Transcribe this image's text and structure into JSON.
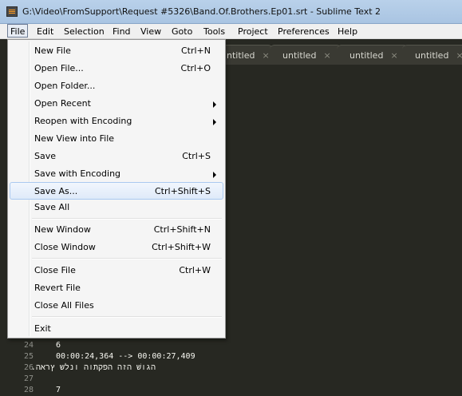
{
  "window": {
    "title": "G:\\Video\\FromSupport\\Request #5326\\Band.Of.Brothers.Ep01.srt - Sublime Text 2"
  },
  "menubar": [
    "File",
    "Edit",
    "Selection",
    "Find",
    "View",
    "Goto",
    "Tools",
    "Project",
    "Preferences",
    "Help"
  ],
  "tabs": [
    {
      "label": "ntitled",
      "close": "×"
    },
    {
      "label": "untitled",
      "close": "×"
    },
    {
      "label": "untitled",
      "close": "×"
    },
    {
      "label": "untitled",
      "close": "×"
    }
  ],
  "file_menu": {
    "items": [
      {
        "label": "New File",
        "shortcut": "Ctrl+N"
      },
      {
        "label": "Open File...",
        "shortcut": "Ctrl+O"
      },
      {
        "label": "Open Folder...",
        "shortcut": ""
      },
      {
        "label": "Open Recent",
        "shortcut": ""
      },
      {
        "label": "Reopen with Encoding",
        "shortcut": ""
      },
      {
        "label": "New View into File",
        "shortcut": ""
      },
      {
        "label": "Save",
        "shortcut": "Ctrl+S"
      },
      {
        "label": "Save with Encoding",
        "shortcut": ""
      },
      {
        "label": "Save As...",
        "shortcut": "Ctrl+Shift+S"
      },
      {
        "label": "Save All",
        "shortcut": ""
      },
      {
        "label": "New Window",
        "shortcut": "Ctrl+Shift+N"
      },
      {
        "label": "Close Window",
        "shortcut": "Ctrl+Shift+W"
      },
      {
        "label": "Close File",
        "shortcut": "Ctrl+W"
      },
      {
        "label": "Revert File",
        "shortcut": ""
      },
      {
        "label": "Close All Files",
        "shortcut": ""
      },
      {
        "label": "Exit",
        "shortcut": ""
      }
    ]
  },
  "editor": {
    "lines": [
      {
        "num": "24",
        "text": "6"
      },
      {
        "num": "25",
        "text": "00:00:24,364 --> 00:00:27,409"
      },
      {
        "num": "26",
        "text": "הגושׁ הזה הפקתוה ונלש ץראה."
      },
      {
        "num": "27",
        "text": ""
      },
      {
        "num": "28",
        "text": "7"
      }
    ]
  },
  "colors": {
    "editor_bg": "#272822",
    "menu_bg": "#f5f5f5",
    "highlight_border": "#aac9f0"
  }
}
